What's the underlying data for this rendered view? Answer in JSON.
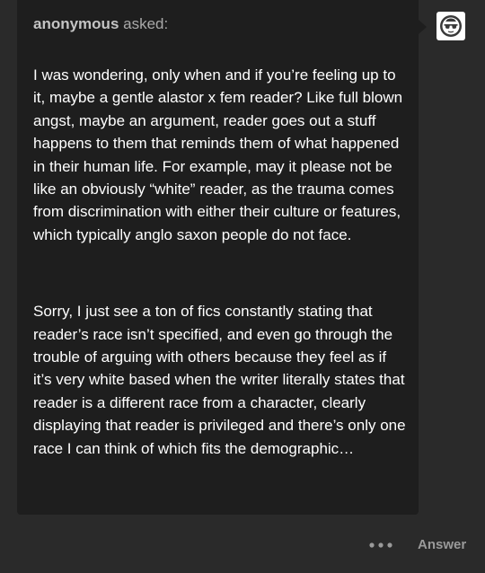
{
  "ask": {
    "asker": "anonymous",
    "asked_label": " asked:",
    "paragraphs": [
      "I was wondering, only when and if you’re feeling up to it, maybe a gentle alastor x fem reader? Like full blown angst, maybe an argument, reader goes out a stuff happens to them that reminds them of what happened in their human life. For example, may it please not be like an obviously “white” reader, as the trauma comes from discrimination with either their culture or features, which typically anglo saxon people do not face.",
      "Sorry, I just see a ton of fics constantly stating that reader’s race isn’t specified, and even go through the trouble of arguing with others because they feel as if it’s very white based when the writer literally states that reader is a different race from a character, clearly displaying that reader is privileged and there’s only one race I can think of which fits the demographic…"
    ]
  },
  "avatar": {
    "icon": "anonymous-sunglasses-avatar-icon"
  },
  "footer": {
    "more_icon": "more-dots-icon",
    "answer_label": "Answer"
  },
  "colors": {
    "page_background": "#2a2a2a",
    "card_background": "#1e1e1e",
    "text": "#ffffff",
    "muted_text": "#9a9a9a"
  }
}
